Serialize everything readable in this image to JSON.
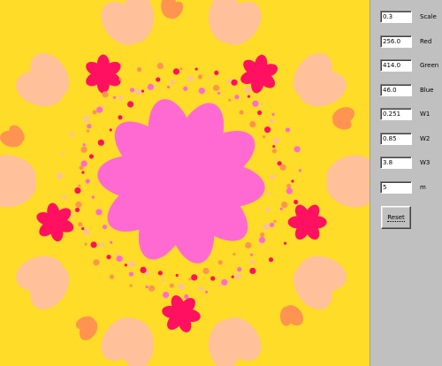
{
  "params": [
    {
      "value": "0.3",
      "label": "Scale"
    },
    {
      "value": "256.0",
      "label": "Red"
    },
    {
      "value": "414.0",
      "label": "Green"
    },
    {
      "value": "46.0",
      "label": "Blue"
    },
    {
      "value": "0.251",
      "label": "W1"
    },
    {
      "value": "0.85",
      "label": "W2"
    },
    {
      "value": "3.8",
      "label": "W3"
    },
    {
      "value": "5",
      "label": "m"
    }
  ],
  "reset_label": "Reset",
  "colors": {
    "background": "#ffdc28",
    "center_flower": "#ff6ad2",
    "peach": "#ffc09a",
    "crimson": "#ff1060",
    "orange": "#ff9450",
    "panel": "#c0c0c0"
  }
}
